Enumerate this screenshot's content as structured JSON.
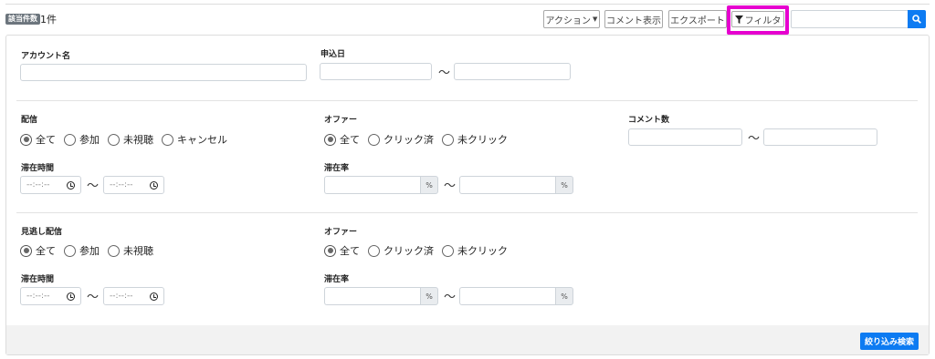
{
  "header": {
    "badge": "該当件数",
    "count": "1件",
    "action_label": "アクション",
    "comment_display_label": "コメント表示",
    "export_label": "エクスポート",
    "filter_label": "フィルタ",
    "search_value": ""
  },
  "filters": {
    "account_name_label": "アカウント名",
    "apply_date_label": "申込日",
    "tilde": "〜",
    "live": {
      "label": "配信",
      "options": [
        "全て",
        "参加",
        "未視聴",
        "キャンセル"
      ],
      "selected": "全て",
      "stay_time_label": "滞在時間",
      "time_placeholder": "--:--:--"
    },
    "live_offer": {
      "label": "オファー",
      "options": [
        "全て",
        "クリック済",
        "未クリック"
      ],
      "selected": "全て",
      "stay_rate_label": "滞在率",
      "pct": "%"
    },
    "comment_count_label": "コメント数",
    "replay": {
      "label": "見逃し配信",
      "options": [
        "全て",
        "参加",
        "未視聴"
      ],
      "selected": "全て",
      "stay_time_label": "滞在時間",
      "time_placeholder": "--:--:--"
    },
    "replay_offer": {
      "label": "オファー",
      "options": [
        "全て",
        "クリック済",
        "未クリック"
      ],
      "selected": "全て",
      "stay_rate_label": "滞在率",
      "pct": "%"
    }
  },
  "footer": {
    "submit_label": "絞り込み検索"
  },
  "colors": {
    "primary": "#0d7bf2",
    "highlight": "#e600cf"
  }
}
